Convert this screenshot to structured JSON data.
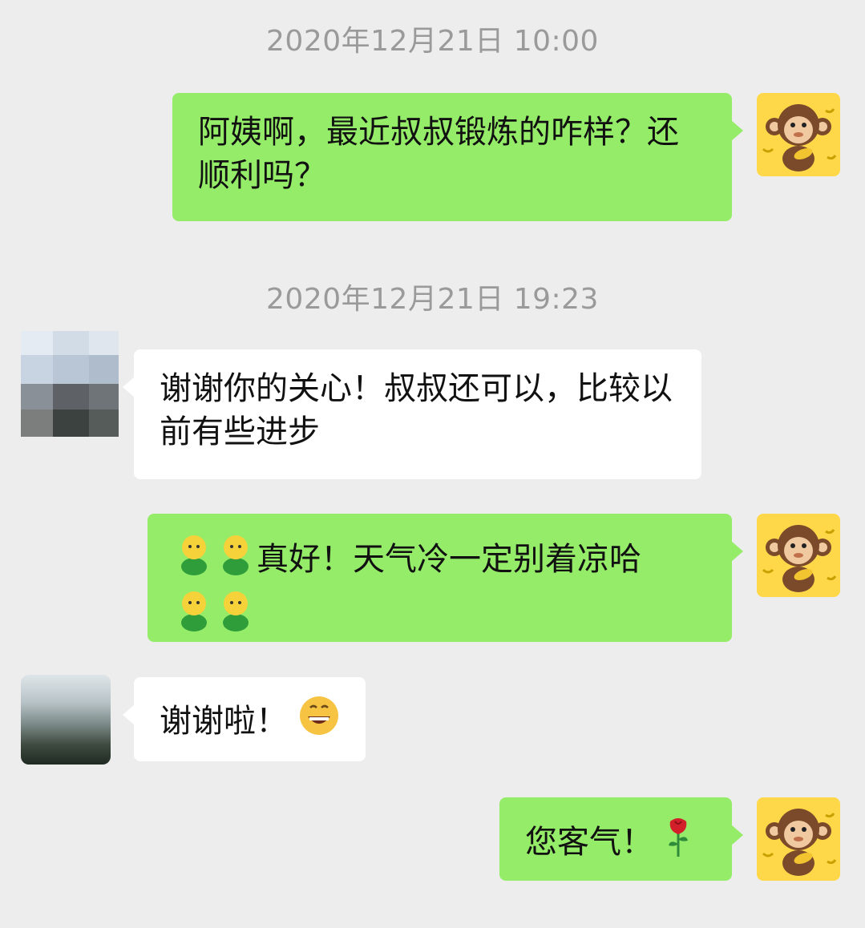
{
  "timestamps": [
    "2020年12月21日 10:00",
    "2020年12月21日 19:23"
  ],
  "messages": [
    {
      "from": "me",
      "text": "阿姨啊，最近叔叔锻炼的咋样？还顺利吗？",
      "avatar": "monkey-avatar"
    },
    {
      "from": "them",
      "text": "谢谢你的关心！叔叔还可以，比较以前有些进步",
      "avatar": "pixelated-avatar"
    },
    {
      "from": "me",
      "text_line1": "真好！天气冷一定别着凉哈",
      "emoji": "person-emoji",
      "avatar": "monkey-avatar"
    },
    {
      "from": "them",
      "text": "谢谢啦！",
      "emoji": "grin-emoji",
      "avatar": "landscape-avatar"
    },
    {
      "from": "me",
      "text": "您客气！",
      "emoji": "rose-emoji",
      "avatar": "monkey-avatar"
    }
  ],
  "colors": {
    "background": "#ededed",
    "my_bubble": "#95ec69",
    "their_bubble": "#ffffff",
    "timestamp": "#9a9a9a"
  }
}
